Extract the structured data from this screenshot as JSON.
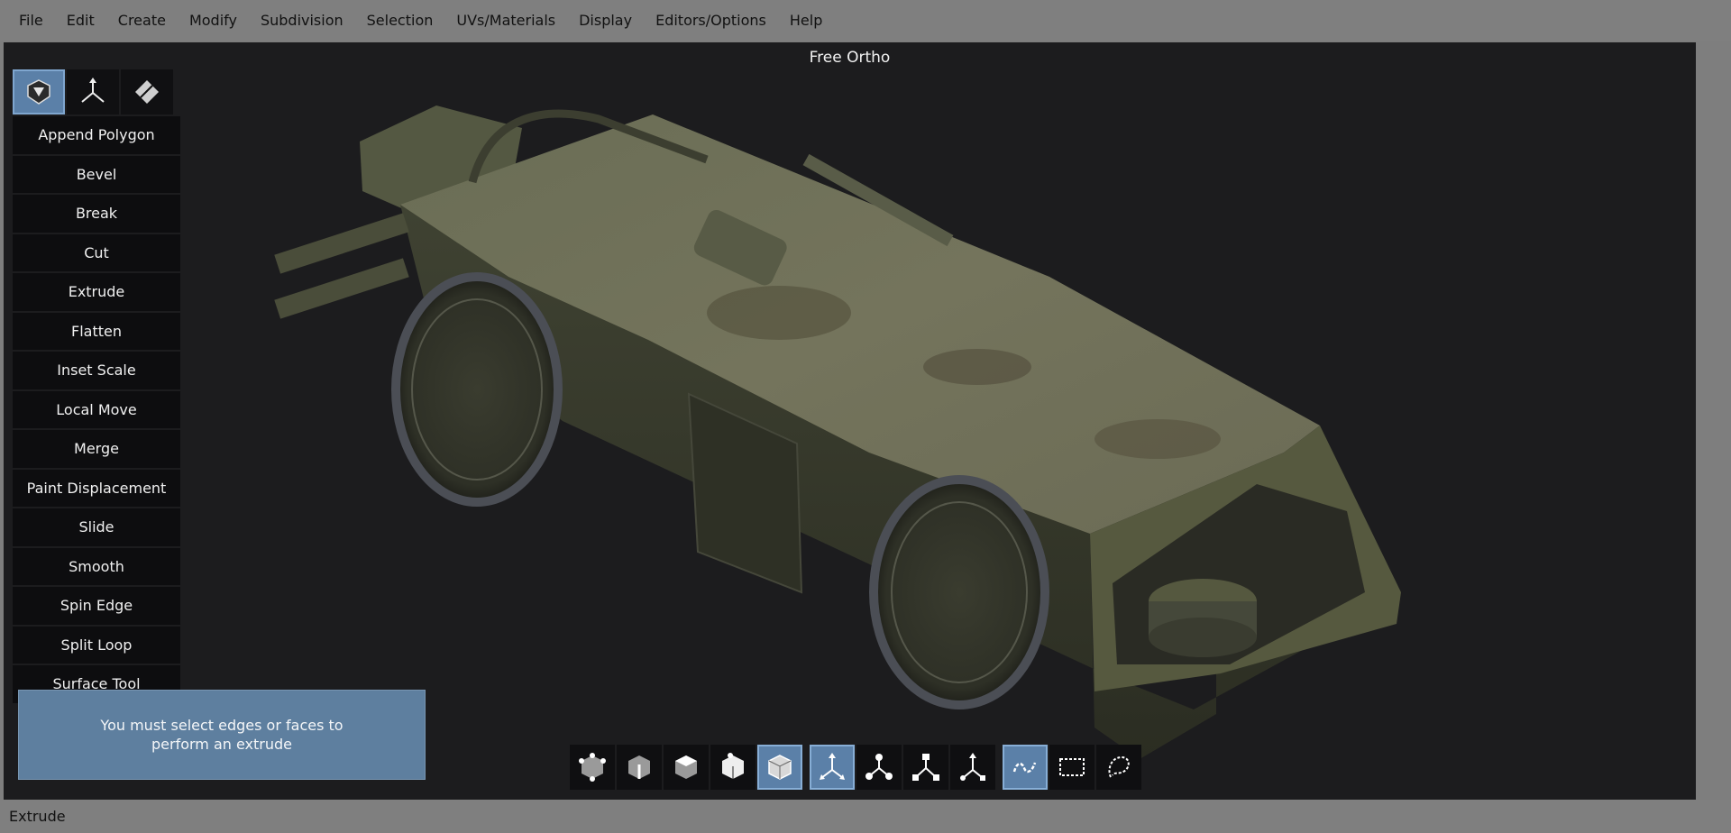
{
  "menubar": {
    "items": [
      "File",
      "Edit",
      "Create",
      "Modify",
      "Subdivision",
      "Selection",
      "UVs/Materials",
      "Display",
      "Editors/Options",
      "Help"
    ]
  },
  "viewport": {
    "title": "Free Ortho"
  },
  "tool_panel": {
    "tabs": [
      {
        "name": "polygon-tools-tab",
        "icon": "cube-shield-icon",
        "active": true
      },
      {
        "name": "transform-tools-tab",
        "icon": "axes-icon",
        "active": false
      },
      {
        "name": "uv-tools-tab",
        "icon": "diamond-icon",
        "active": false
      }
    ],
    "tools": [
      "Append Polygon",
      "Bevel",
      "Break",
      "Cut",
      "Extrude",
      "Flatten",
      "Inset Scale",
      "Local Move",
      "Merge",
      "Paint Displacement",
      "Slide",
      "Smooth",
      "Spin Edge",
      "Split Loop",
      "Surface Tool"
    ]
  },
  "toast": {
    "message": "You must select edges or faces to perform an extrude"
  },
  "bottom_toolbar": {
    "component_modes": [
      "vertex-mode-icon",
      "edge-mode-icon",
      "face-mode-icon",
      "element-mode-icon",
      "object-mode-icon"
    ],
    "active_component": 4,
    "transform_modes": [
      "move-icon",
      "rotate-icon",
      "scale-icon",
      "universal-transform-icon"
    ],
    "active_transform": 0,
    "selection_modes": [
      "paint-select-icon",
      "box-select-icon",
      "lasso-select-icon"
    ],
    "active_selection": 0
  },
  "statusbar": {
    "text": "Extrude"
  },
  "colors": {
    "accent": "#5b80a8",
    "viewport_bg": "#1c1c1e",
    "panel_btn": "#0d0d0f",
    "vehicle": "#5f6548"
  }
}
